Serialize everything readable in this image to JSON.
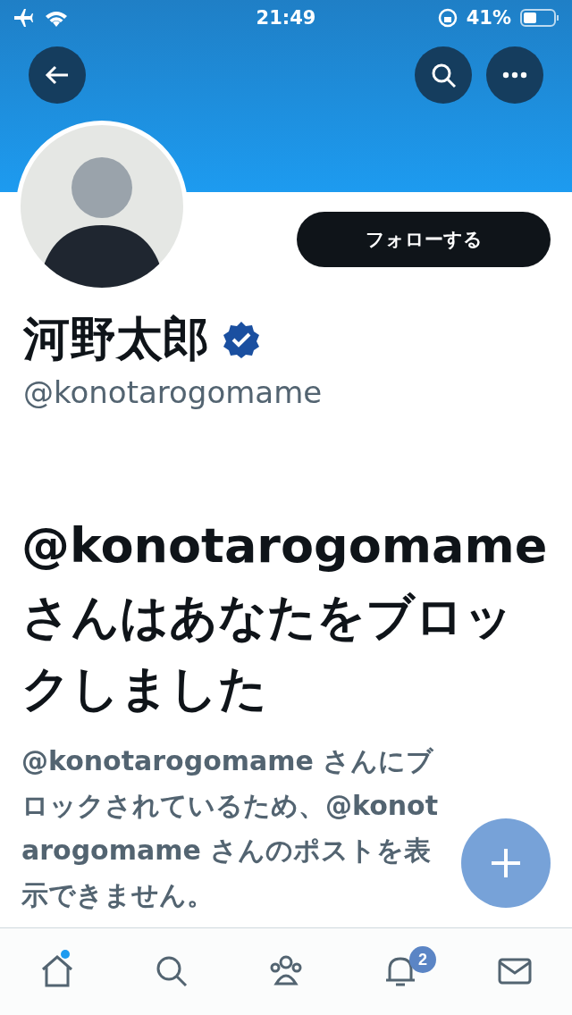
{
  "status_bar": {
    "time": "21:49",
    "battery": "41%"
  },
  "profile": {
    "follow_button": "フォローする",
    "name": "河野太郎",
    "verified": true,
    "handle": "@konotarogomame"
  },
  "blocked": {
    "title": "@konotarogomame さんはあなたをブロックしました",
    "message": "@konotarogomame さんにブロックされているため、@konotarogomame さんのポストを表示できません。"
  },
  "tab_bar": {
    "items": [
      {
        "kind": "home",
        "dot": true
      },
      {
        "kind": "search",
        "dot": false
      },
      {
        "kind": "communities",
        "dot": false
      },
      {
        "kind": "bell",
        "badge": "2",
        "dot": false
      },
      {
        "kind": "mail",
        "dot": false
      }
    ]
  }
}
